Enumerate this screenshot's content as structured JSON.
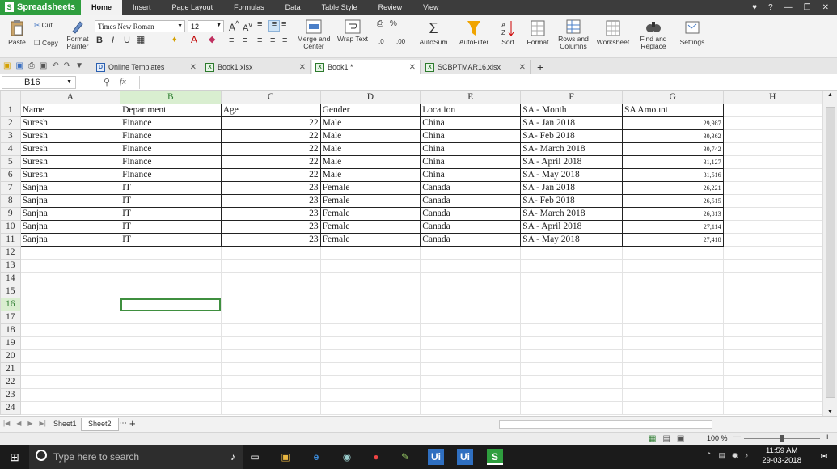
{
  "app": {
    "name": "Spreadsheets"
  },
  "menu": [
    "Home",
    "Insert",
    "Page Layout",
    "Formulas",
    "Data",
    "Table Style",
    "Review",
    "View"
  ],
  "ribbon": {
    "paste": "Paste",
    "cut": "Cut",
    "copy": "Copy",
    "format_painter": "Format Painter",
    "font_name": "Times New Roman",
    "font_size": "12",
    "merge_center": "Merge and Center",
    "wrap_text": "Wrap Text",
    "autosum": "AutoSum",
    "autofilter": "AutoFilter",
    "sort": "Sort",
    "format": "Format",
    "rows_columns": "Rows and Columns",
    "worksheet": "Worksheet",
    "find_replace": "Find and Replace",
    "settings": "Settings",
    "percent": "%"
  },
  "doc_tabs": [
    {
      "label": "Online Templates"
    },
    {
      "label": "Book1.xlsx"
    },
    {
      "label": "Book1 *"
    },
    {
      "label": "SCBPTMAR16.xlsx"
    }
  ],
  "formula_bar": {
    "cell_ref": "B16",
    "fx": "fx",
    "value": ""
  },
  "columns": [
    "A",
    "B",
    "C",
    "D",
    "E",
    "F",
    "G",
    "H"
  ],
  "rows": [
    [
      "Name",
      "Department",
      "Age",
      "Gender",
      "Location",
      "SA - Month",
      "SA Amount"
    ],
    [
      "Suresh",
      "Finance",
      "22",
      "Male",
      "China",
      "SA - Jan 2018",
      "29,987"
    ],
    [
      "Suresh",
      "Finance",
      "22",
      "Male",
      "China",
      "SA- Feb 2018",
      "30,362"
    ],
    [
      "Suresh",
      "Finance",
      "22",
      "Male",
      "China",
      "SA- March 2018",
      "30,742"
    ],
    [
      "Suresh",
      "Finance",
      "22",
      "Male",
      "China",
      "SA - April 2018",
      "31,127"
    ],
    [
      "Suresh",
      "Finance",
      "22",
      "Male",
      "China",
      "SA - May 2018",
      "31,516"
    ],
    [
      "Sanjna",
      "IT",
      "23",
      "Female",
      "Canada",
      "SA - Jan 2018",
      "26,221"
    ],
    [
      "Sanjna",
      "IT",
      "23",
      "Female",
      "Canada",
      "SA- Feb 2018",
      "26,515"
    ],
    [
      "Sanjna",
      "IT",
      "23",
      "Female",
      "Canada",
      "SA- March 2018",
      "26,813"
    ],
    [
      "Sanjna",
      "IT",
      "23",
      "Female",
      "Canada",
      "SA - April 2018",
      "27,114"
    ],
    [
      "Sanjna",
      "IT",
      "23",
      "Female",
      "Canada",
      "SA - May 2018",
      "27,418"
    ]
  ],
  "row_count": 24,
  "selected": {
    "row": 16,
    "col": "B"
  },
  "sheets": [
    {
      "label": "Sheet1"
    },
    {
      "label": "Sheet2"
    }
  ],
  "status": {
    "zoom": "100 %"
  },
  "taskbar": {
    "search_placeholder": "Type here to search",
    "time": "11:59 AM",
    "date": "29-03-2018"
  },
  "colors": {
    "brand": "#2e9e3e",
    "selection": "#3f8f3f",
    "titlebar": "#3c3c3c"
  }
}
